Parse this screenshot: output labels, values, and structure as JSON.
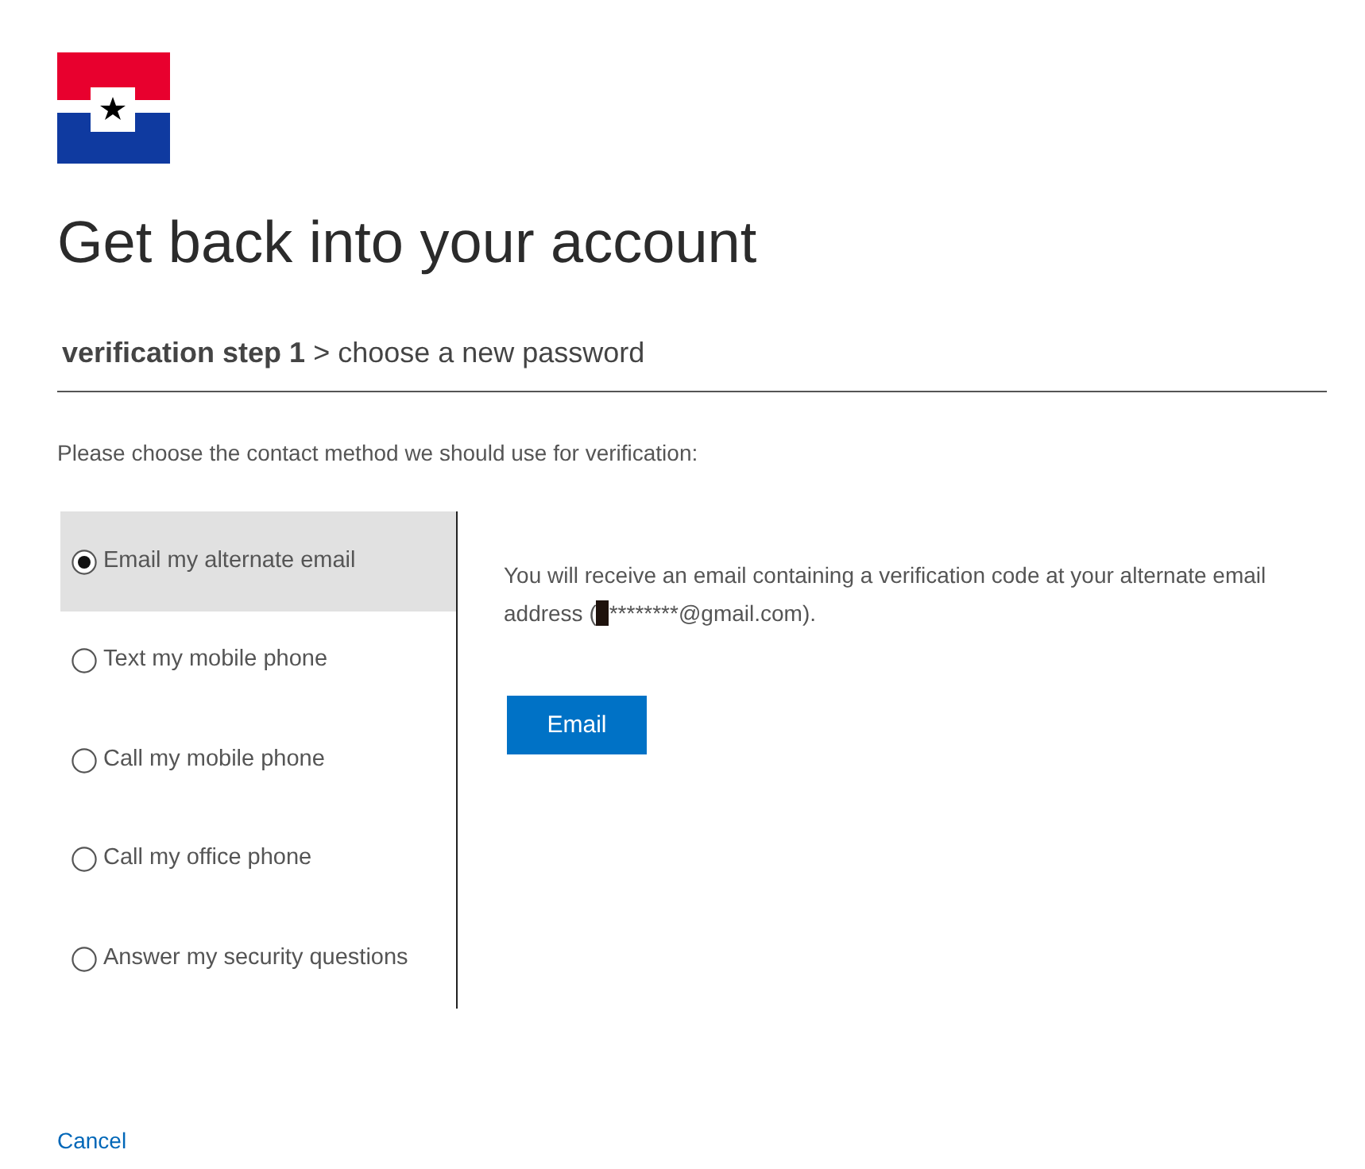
{
  "title": "Get back into your account",
  "steps": {
    "current": "verification step 1",
    "separator": ">",
    "next": "choose a new password"
  },
  "instruction": "Please choose the contact method we should use for verification:",
  "methods": [
    {
      "label": "Email my alternate email",
      "selected": true
    },
    {
      "label": "Text my mobile phone",
      "selected": false
    },
    {
      "label": "Call my mobile phone",
      "selected": false
    },
    {
      "label": "Call my office phone",
      "selected": false
    },
    {
      "label": "Answer my security questions",
      "selected": false
    }
  ],
  "detail": {
    "text_before": "You will receive an email containing a verification code at your alternate email address (",
    "redacted": true,
    "text_after": "********@gmail.com).",
    "button": "Email"
  },
  "cancel": "Cancel"
}
